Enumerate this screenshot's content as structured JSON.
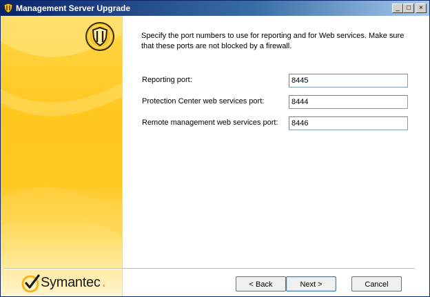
{
  "window": {
    "title": "Management Server Upgrade",
    "controls": {
      "minimize": "_",
      "maximize": "□",
      "close": "×"
    }
  },
  "brand": {
    "name": "Symantec",
    "trademark": "."
  },
  "content": {
    "description": "Specify the port numbers to use for reporting and for Web services. Make sure that these ports are not blocked by a firewall.",
    "fields": [
      {
        "label": "Reporting port:",
        "value": "8445"
      },
      {
        "label": "Protection Center web services port:",
        "value": "8444"
      },
      {
        "label": "Remote management web services port:",
        "value": "8446"
      }
    ]
  },
  "buttons": {
    "back": "< Back",
    "next": "Next >",
    "cancel": "Cancel"
  },
  "colors": {
    "title_bar": "#0a246a",
    "accent_yellow": "#ffc61e",
    "logo_check": "#f3b51b"
  },
  "icons": [
    "shield-icon",
    "symantec-check-icon",
    "minimize-icon",
    "maximize-icon",
    "close-icon"
  ]
}
